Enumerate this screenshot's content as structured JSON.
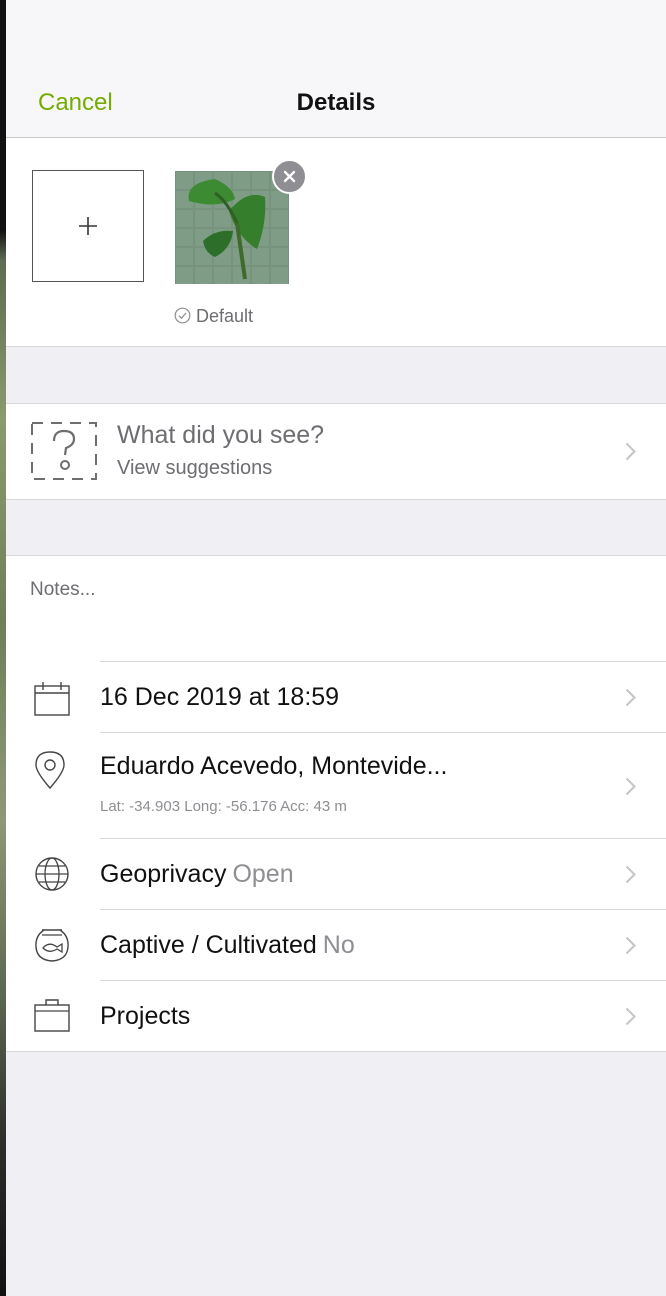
{
  "nav": {
    "cancel": "Cancel",
    "title": "Details"
  },
  "photos": {
    "default_label": "Default"
  },
  "identify": {
    "title": "What did you see?",
    "subtitle": "View suggestions"
  },
  "notes": {
    "placeholder": "Notes..."
  },
  "rows": {
    "date": {
      "label": "16 Dec 2019 at 18:59"
    },
    "location": {
      "label": "Eduardo Acevedo, Montevide...",
      "sub": "Lat: -34.903  Long: -56.176  Acc: 43 m"
    },
    "geoprivacy": {
      "label": "Geoprivacy",
      "value": "Open"
    },
    "captive": {
      "label": "Captive / Cultivated",
      "value": "No"
    },
    "projects": {
      "label": "Projects"
    }
  },
  "colors": {
    "accent": "#74ac00",
    "background": "#efeff4"
  },
  "icons": [
    "plus-icon",
    "close-icon",
    "check-circle-icon",
    "question-box-icon",
    "chevron-right-icon",
    "calendar-icon",
    "location-pin-icon",
    "globe-icon",
    "fishbowl-icon",
    "briefcase-icon"
  ]
}
